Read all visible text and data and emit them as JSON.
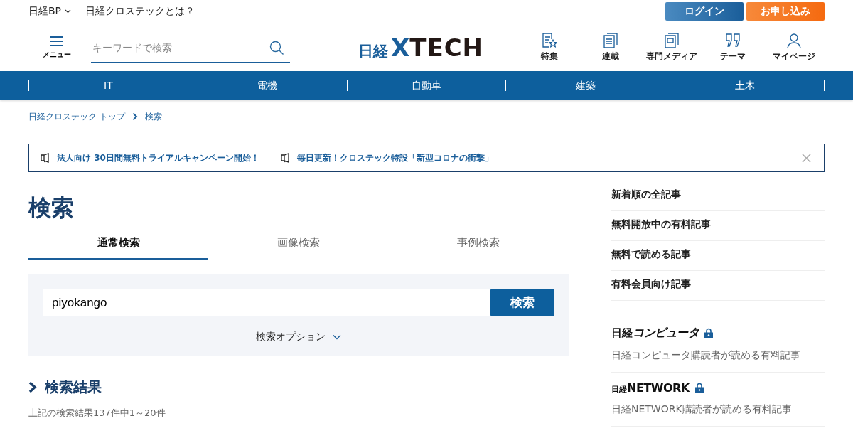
{
  "top_bar": {
    "links": [
      {
        "label": "日経BP",
        "dropdown": true
      },
      {
        "label": "日経クロステックとは？",
        "dropdown": false
      }
    ],
    "buttons": [
      {
        "label": "ログイン",
        "kind": "login"
      },
      {
        "label": "お申し込み",
        "kind": "signup"
      }
    ]
  },
  "header": {
    "menu_label": "メニュー",
    "search": {
      "placeholder": "キーワードで検索"
    },
    "logo": {
      "prefix": "日経",
      "mark": "X",
      "name": "TECH"
    },
    "icons": [
      {
        "label": "特集",
        "kind": "feature"
      },
      {
        "label": "連載",
        "kind": "series"
      },
      {
        "label": "専門メディア",
        "kind": "media"
      },
      {
        "label": "テーマ",
        "kind": "theme"
      },
      {
        "label": "マイページ",
        "kind": "user"
      }
    ]
  },
  "nav": [
    "IT",
    "電機",
    "自動車",
    "建築",
    "土木"
  ],
  "breadcrumb": [
    "日経クロステック トップ",
    "検索"
  ],
  "notices": [
    "法人向け 30日間無料トライアルキャンペーン開始！",
    "毎日更新！クロステック特設「新型コロナの衝撃」"
  ],
  "page_title": "検索",
  "tabs": [
    {
      "label": "通常検索",
      "selected": true
    },
    {
      "label": "画像検索",
      "selected": false
    },
    {
      "label": "事例検索",
      "selected": false
    }
  ],
  "search_form": {
    "value": "piyokango",
    "button": "検索",
    "options": "検索オプション"
  },
  "results": {
    "heading": "検索結果",
    "summary": "上記の検索結果137件中1～20件"
  },
  "sidebar": {
    "links": [
      "新着順の全記事",
      "無料開放中の有料記事",
      "無料で読める記事",
      "有料会員向け記事"
    ],
    "publications": [
      {
        "logo_prefix": "日経",
        "logo_name": "コンピュータ",
        "locked": true,
        "description": "日経コンピュータ購読者が読める有料記事"
      },
      {
        "logo_prefix": "日経",
        "logo_name": "NETWORK",
        "locked": true,
        "description": "日経NETWORK購読者が読める有料記事"
      }
    ]
  }
}
